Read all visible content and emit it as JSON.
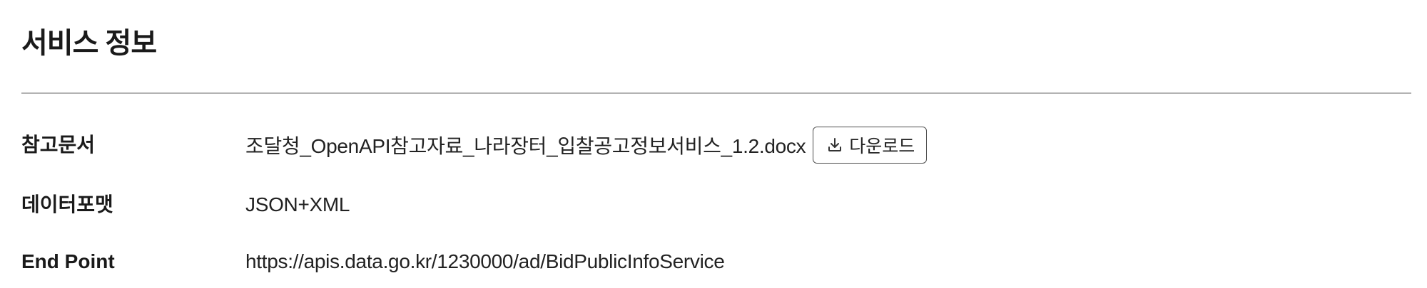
{
  "section": {
    "title": "서비스 정보"
  },
  "info": {
    "reference_doc": {
      "label": "참고문서",
      "file_name": "조달청_OpenAPI참고자료_나라장터_입찰공고정보서비스_1.2.docx",
      "download_label": "다운로드",
      "download_icon": "download-icon"
    },
    "data_format": {
      "label": "데이터포맷",
      "value": "JSON+XML"
    },
    "end_point": {
      "label": "End Point",
      "value": "https://apis.data.go.kr/1230000/ad/BidPublicInfoService"
    }
  }
}
